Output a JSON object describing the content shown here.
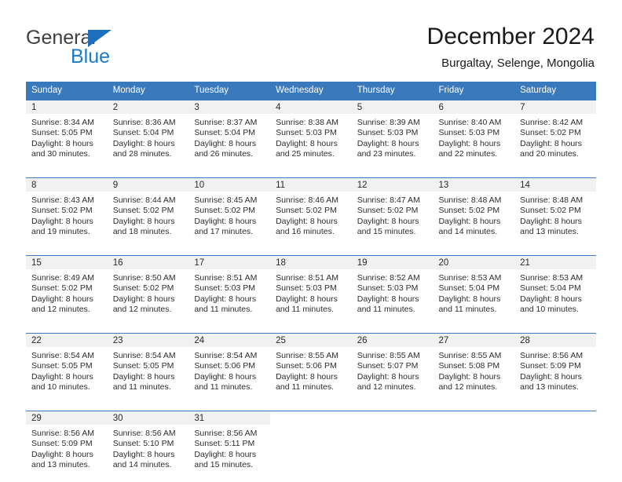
{
  "brand": {
    "name_part1": "General",
    "name_part2": "Blue",
    "triangle_color": "#1c6fba",
    "blue_color": "#1c7ac6"
  },
  "header": {
    "title": "December 2024",
    "subtitle": "Burgaltay, Selenge, Mongolia"
  },
  "theme": {
    "header_blue": "#3b79bd",
    "daynum_band": "#f1f1f1",
    "text": "#2d2d2d"
  },
  "weekday_headers": [
    "Sunday",
    "Monday",
    "Tuesday",
    "Wednesday",
    "Thursday",
    "Friday",
    "Saturday"
  ],
  "weeks": [
    [
      {
        "day": "1",
        "sunrise": "Sunrise: 8:34 AM",
        "sunset": "Sunset: 5:05 PM",
        "daylight1": "Daylight: 8 hours",
        "daylight2": "and 30 minutes."
      },
      {
        "day": "2",
        "sunrise": "Sunrise: 8:36 AM",
        "sunset": "Sunset: 5:04 PM",
        "daylight1": "Daylight: 8 hours",
        "daylight2": "and 28 minutes."
      },
      {
        "day": "3",
        "sunrise": "Sunrise: 8:37 AM",
        "sunset": "Sunset: 5:04 PM",
        "daylight1": "Daylight: 8 hours",
        "daylight2": "and 26 minutes."
      },
      {
        "day": "4",
        "sunrise": "Sunrise: 8:38 AM",
        "sunset": "Sunset: 5:03 PM",
        "daylight1": "Daylight: 8 hours",
        "daylight2": "and 25 minutes."
      },
      {
        "day": "5",
        "sunrise": "Sunrise: 8:39 AM",
        "sunset": "Sunset: 5:03 PM",
        "daylight1": "Daylight: 8 hours",
        "daylight2": "and 23 minutes."
      },
      {
        "day": "6",
        "sunrise": "Sunrise: 8:40 AM",
        "sunset": "Sunset: 5:03 PM",
        "daylight1": "Daylight: 8 hours",
        "daylight2": "and 22 minutes."
      },
      {
        "day": "7",
        "sunrise": "Sunrise: 8:42 AM",
        "sunset": "Sunset: 5:02 PM",
        "daylight1": "Daylight: 8 hours",
        "daylight2": "and 20 minutes."
      }
    ],
    [
      {
        "day": "8",
        "sunrise": "Sunrise: 8:43 AM",
        "sunset": "Sunset: 5:02 PM",
        "daylight1": "Daylight: 8 hours",
        "daylight2": "and 19 minutes."
      },
      {
        "day": "9",
        "sunrise": "Sunrise: 8:44 AM",
        "sunset": "Sunset: 5:02 PM",
        "daylight1": "Daylight: 8 hours",
        "daylight2": "and 18 minutes."
      },
      {
        "day": "10",
        "sunrise": "Sunrise: 8:45 AM",
        "sunset": "Sunset: 5:02 PM",
        "daylight1": "Daylight: 8 hours",
        "daylight2": "and 17 minutes."
      },
      {
        "day": "11",
        "sunrise": "Sunrise: 8:46 AM",
        "sunset": "Sunset: 5:02 PM",
        "daylight1": "Daylight: 8 hours",
        "daylight2": "and 16 minutes."
      },
      {
        "day": "12",
        "sunrise": "Sunrise: 8:47 AM",
        "sunset": "Sunset: 5:02 PM",
        "daylight1": "Daylight: 8 hours",
        "daylight2": "and 15 minutes."
      },
      {
        "day": "13",
        "sunrise": "Sunrise: 8:48 AM",
        "sunset": "Sunset: 5:02 PM",
        "daylight1": "Daylight: 8 hours",
        "daylight2": "and 14 minutes."
      },
      {
        "day": "14",
        "sunrise": "Sunrise: 8:48 AM",
        "sunset": "Sunset: 5:02 PM",
        "daylight1": "Daylight: 8 hours",
        "daylight2": "and 13 minutes."
      }
    ],
    [
      {
        "day": "15",
        "sunrise": "Sunrise: 8:49 AM",
        "sunset": "Sunset: 5:02 PM",
        "daylight1": "Daylight: 8 hours",
        "daylight2": "and 12 minutes."
      },
      {
        "day": "16",
        "sunrise": "Sunrise: 8:50 AM",
        "sunset": "Sunset: 5:02 PM",
        "daylight1": "Daylight: 8 hours",
        "daylight2": "and 12 minutes."
      },
      {
        "day": "17",
        "sunrise": "Sunrise: 8:51 AM",
        "sunset": "Sunset: 5:03 PM",
        "daylight1": "Daylight: 8 hours",
        "daylight2": "and 11 minutes."
      },
      {
        "day": "18",
        "sunrise": "Sunrise: 8:51 AM",
        "sunset": "Sunset: 5:03 PM",
        "daylight1": "Daylight: 8 hours",
        "daylight2": "and 11 minutes."
      },
      {
        "day": "19",
        "sunrise": "Sunrise: 8:52 AM",
        "sunset": "Sunset: 5:03 PM",
        "daylight1": "Daylight: 8 hours",
        "daylight2": "and 11 minutes."
      },
      {
        "day": "20",
        "sunrise": "Sunrise: 8:53 AM",
        "sunset": "Sunset: 5:04 PM",
        "daylight1": "Daylight: 8 hours",
        "daylight2": "and 11 minutes."
      },
      {
        "day": "21",
        "sunrise": "Sunrise: 8:53 AM",
        "sunset": "Sunset: 5:04 PM",
        "daylight1": "Daylight: 8 hours",
        "daylight2": "and 10 minutes."
      }
    ],
    [
      {
        "day": "22",
        "sunrise": "Sunrise: 8:54 AM",
        "sunset": "Sunset: 5:05 PM",
        "daylight1": "Daylight: 8 hours",
        "daylight2": "and 10 minutes."
      },
      {
        "day": "23",
        "sunrise": "Sunrise: 8:54 AM",
        "sunset": "Sunset: 5:05 PM",
        "daylight1": "Daylight: 8 hours",
        "daylight2": "and 11 minutes."
      },
      {
        "day": "24",
        "sunrise": "Sunrise: 8:54 AM",
        "sunset": "Sunset: 5:06 PM",
        "daylight1": "Daylight: 8 hours",
        "daylight2": "and 11 minutes."
      },
      {
        "day": "25",
        "sunrise": "Sunrise: 8:55 AM",
        "sunset": "Sunset: 5:06 PM",
        "daylight1": "Daylight: 8 hours",
        "daylight2": "and 11 minutes."
      },
      {
        "day": "26",
        "sunrise": "Sunrise: 8:55 AM",
        "sunset": "Sunset: 5:07 PM",
        "daylight1": "Daylight: 8 hours",
        "daylight2": "and 12 minutes."
      },
      {
        "day": "27",
        "sunrise": "Sunrise: 8:55 AM",
        "sunset": "Sunset: 5:08 PM",
        "daylight1": "Daylight: 8 hours",
        "daylight2": "and 12 minutes."
      },
      {
        "day": "28",
        "sunrise": "Sunrise: 8:56 AM",
        "sunset": "Sunset: 5:09 PM",
        "daylight1": "Daylight: 8 hours",
        "daylight2": "and 13 minutes."
      }
    ],
    [
      {
        "day": "29",
        "sunrise": "Sunrise: 8:56 AM",
        "sunset": "Sunset: 5:09 PM",
        "daylight1": "Daylight: 8 hours",
        "daylight2": "and 13 minutes."
      },
      {
        "day": "30",
        "sunrise": "Sunrise: 8:56 AM",
        "sunset": "Sunset: 5:10 PM",
        "daylight1": "Daylight: 8 hours",
        "daylight2": "and 14 minutes."
      },
      {
        "day": "31",
        "sunrise": "Sunrise: 8:56 AM",
        "sunset": "Sunset: 5:11 PM",
        "daylight1": "Daylight: 8 hours",
        "daylight2": "and 15 minutes."
      },
      {
        "day": "",
        "sunrise": "",
        "sunset": "",
        "daylight1": "",
        "daylight2": ""
      },
      {
        "day": "",
        "sunrise": "",
        "sunset": "",
        "daylight1": "",
        "daylight2": ""
      },
      {
        "day": "",
        "sunrise": "",
        "sunset": "",
        "daylight1": "",
        "daylight2": ""
      },
      {
        "day": "",
        "sunrise": "",
        "sunset": "",
        "daylight1": "",
        "daylight2": ""
      }
    ]
  ]
}
